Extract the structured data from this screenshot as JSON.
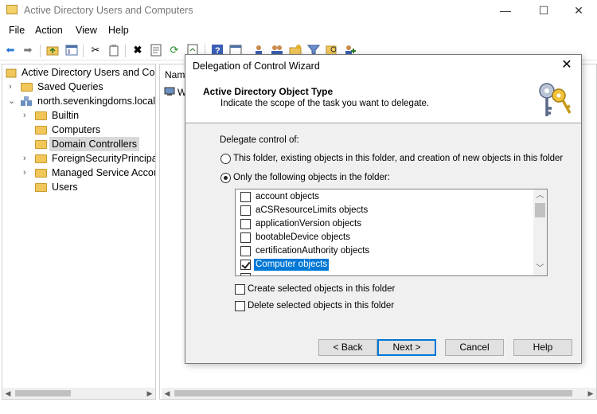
{
  "window": {
    "title": "Active Directory Users and Computers",
    "controls": {
      "minimize": "—",
      "maximize": "☐",
      "close": "✕"
    }
  },
  "menu": [
    "File",
    "Action",
    "View",
    "Help"
  ],
  "toolbar_icons": [
    "back-icon",
    "forward-icon",
    "up-folder-icon",
    "show-tree-icon",
    "cut-icon",
    "copy-icon",
    "delete-icon",
    "properties-icon",
    "refresh-icon",
    "export-icon",
    "help-icon",
    "help-topics-icon",
    "users-icon",
    "groups-icon",
    "ou-icon",
    "filter-icon",
    "find-icon",
    "add-to-group-icon"
  ],
  "tree": {
    "root": "Active Directory Users and Com",
    "items": [
      {
        "label": "Saved Queries",
        "expander": "›"
      },
      {
        "label": "north.sevenkingdoms.local",
        "expander": "⌄"
      },
      {
        "label": "Builtin",
        "expander": "›"
      },
      {
        "label": "Computers",
        "expander": ""
      },
      {
        "label": "Domain Controllers",
        "expander": ""
      },
      {
        "label": "ForeignSecurityPrincipals",
        "expander": "›"
      },
      {
        "label": "Managed Service Accour",
        "expander": "›"
      },
      {
        "label": "Users",
        "expander": ""
      }
    ]
  },
  "right_pane": {
    "column_header": "Nam",
    "row_text": "W"
  },
  "dialog": {
    "title": "Delegation of Control Wizard",
    "close": "✕",
    "header_title": "Active Directory Object Type",
    "header_subtitle": "Indicate the scope of the task you want to delegate.",
    "delegate_label": "Delegate control of:",
    "radio_folder": {
      "label": "This folder, existing objects in this folder, and creation of new objects in this folder",
      "checked": false
    },
    "radio_only": {
      "label": "Only the following objects in the folder:",
      "checked": true
    },
    "objects": [
      {
        "label": "account objects",
        "checked": false
      },
      {
        "label": "aCSResourceLimits objects",
        "checked": false
      },
      {
        "label": "applicationVersion objects",
        "checked": false
      },
      {
        "label": "bootableDevice objects",
        "checked": false
      },
      {
        "label": "certificationAuthority objects",
        "checked": false
      },
      {
        "label": "Computer objects",
        "checked": true,
        "selected": true
      }
    ],
    "create_selected": {
      "label": "Create selected objects in this folder",
      "checked": false
    },
    "delete_selected": {
      "label": "Delete selected objects in this folder",
      "checked": false
    },
    "buttons": {
      "back": "< Back",
      "next": "Next >",
      "cancel": "Cancel",
      "help": "Help"
    }
  },
  "colors": {
    "selection": "#0078d7",
    "folder": "#f1c75a"
  }
}
